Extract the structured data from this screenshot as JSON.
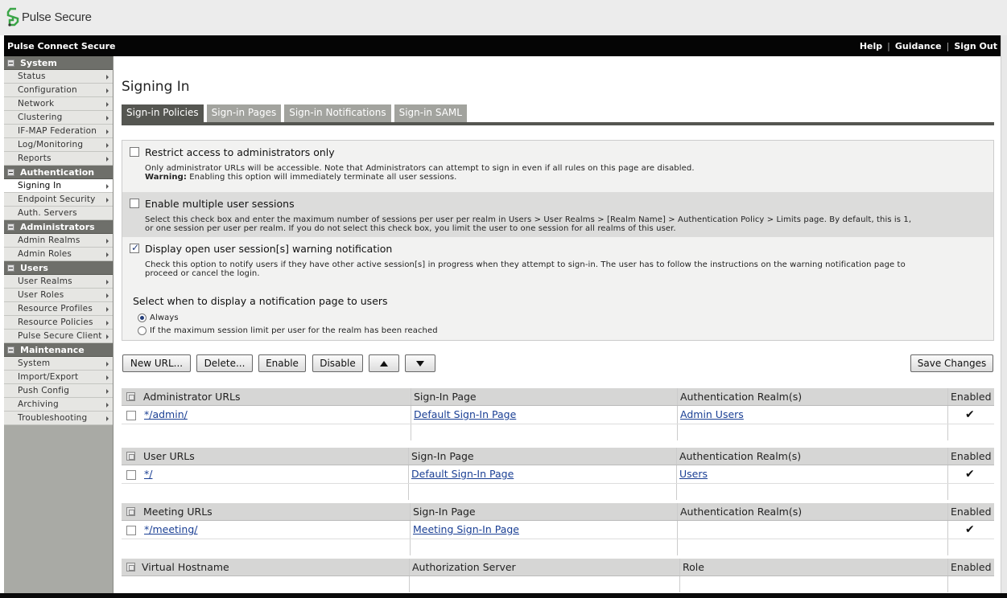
{
  "brand": {
    "name": "Pulse Secure"
  },
  "topbar": {
    "product": "Pulse Connect Secure",
    "links": [
      "Help",
      "Guidance",
      "Sign Out"
    ]
  },
  "sidebar": {
    "sections": [
      {
        "title": "System",
        "items": [
          "Status",
          "Configuration",
          "Network",
          "Clustering",
          "IF-MAP Federation",
          "Log/Monitoring",
          "Reports"
        ]
      },
      {
        "title": "Authentication",
        "items": [
          "Signing In",
          "Endpoint Security",
          "Auth. Servers"
        ]
      },
      {
        "title": "Administrators",
        "items": [
          "Admin Realms",
          "Admin Roles"
        ]
      },
      {
        "title": "Users",
        "items": [
          "User Realms",
          "User Roles",
          "Resource Profiles",
          "Resource Policies",
          "Pulse Secure Client"
        ]
      },
      {
        "title": "Maintenance",
        "items": [
          "System",
          "Import/Export",
          "Push Config",
          "Archiving",
          "Troubleshooting"
        ]
      }
    ]
  },
  "page": {
    "title": "Signing In"
  },
  "tabs": [
    "Sign-in Policies",
    "Sign-in Pages",
    "Sign-in Notifications",
    "Sign-in SAML"
  ],
  "options": {
    "restrict": {
      "label": "Restrict access to administrators only",
      "desc": "Only administrator URLs will be accessible. Note that Administrators can attempt to sign in even if all rules on this page are disabled.",
      "warning_label": "Warning:",
      "warning_text": " Enabling this option will immediately terminate all user sessions.",
      "checked": false
    },
    "multiple": {
      "label": "Enable multiple user sessions",
      "desc1": "Select this check box and enter the maximum number of sessions per user per realm in Users > User Realms > [Realm Name] > Authentication Policy > Limits page. By default, this is 1,",
      "desc2": "or one session per user per realm. If you do not select this check box, you limit the user to one session for all realms of this user.",
      "checked": false
    },
    "warning_notif": {
      "label": "Display open user session[s] warning notification",
      "desc1": "Check this option to notify users if they have other active session[s] in progress when they attempt to sign-in. The user has to follow the instructions on the warning notification page to",
      "desc2": "proceed or cancel the login.",
      "checked": true
    },
    "when": {
      "heading": "Select when to display a notification page to users",
      "always": "Always",
      "max_limit": "If the maximum session limit per user for the realm has been reached",
      "selected": "Always"
    }
  },
  "buttons": {
    "new_url": "New URL...",
    "delete": "Delete...",
    "enable": "Enable",
    "disable": "Disable",
    "save": "Save Changes"
  },
  "tables": {
    "admin": {
      "headers": [
        "Administrator URLs",
        "Sign-In Page",
        "Authentication Realm(s)",
        "Enabled"
      ],
      "rows": [
        {
          "url": "*/admin/",
          "page": "Default Sign-In Page",
          "realm": "Admin Users",
          "enabled": "✔"
        }
      ]
    },
    "user": {
      "headers": [
        "User URLs",
        "Sign-In Page",
        "Authentication Realm(s)",
        "Enabled"
      ],
      "rows": [
        {
          "url": "*/",
          "page": "Default Sign-In Page",
          "realm": "Users",
          "enabled": "✔"
        }
      ]
    },
    "meeting": {
      "headers": [
        "Meeting URLs",
        "Sign-In Page",
        "Authentication Realm(s)",
        "Enabled"
      ],
      "rows": [
        {
          "url": "*/meeting/",
          "page": "Meeting Sign-In Page",
          "realm": "",
          "enabled": "✔"
        }
      ]
    },
    "vhost": {
      "headers": [
        "Virtual Hostname",
        "Authorization Server",
        "Role",
        "Enabled"
      ]
    }
  }
}
